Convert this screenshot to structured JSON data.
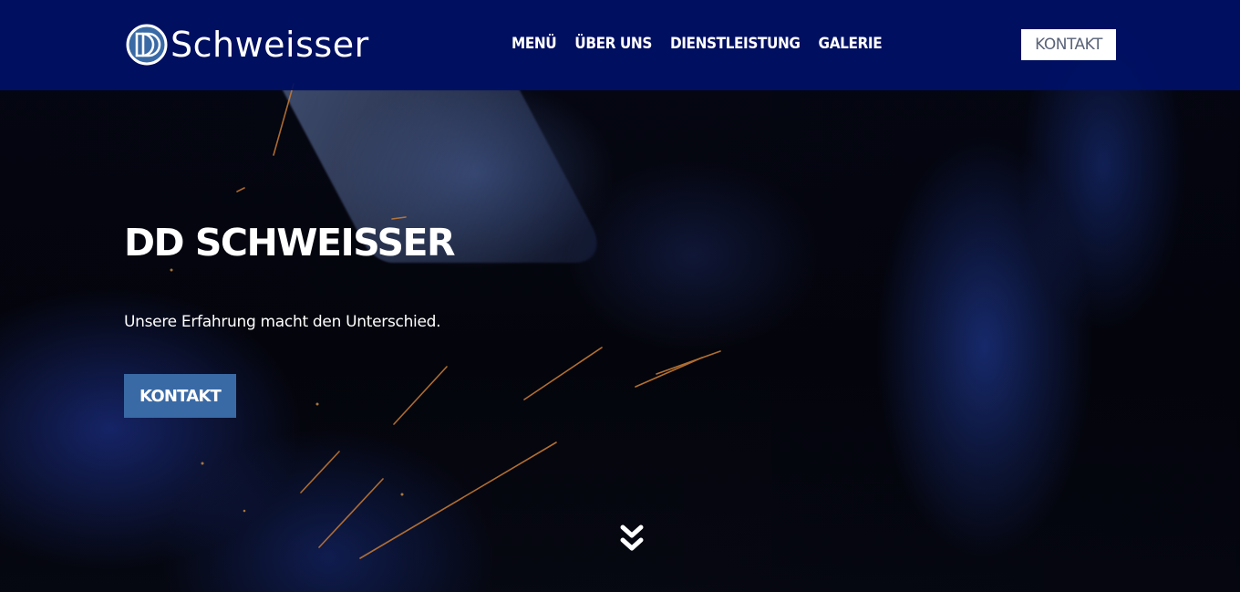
{
  "header": {
    "logo": {
      "mark_text": "DD",
      "brand_text": "Schweisser"
    },
    "nav": {
      "items": [
        {
          "label": "MENÜ"
        },
        {
          "label": "ÜBER UNS"
        },
        {
          "label": "DIENSTLEISTUNG"
        },
        {
          "label": "GALERIE"
        }
      ]
    },
    "contact_button": "KONTAKT"
  },
  "hero": {
    "title": "DD SCHWEISSER",
    "subtitle": "Unsere Erfahrung macht den Unterschied.",
    "cta_label": "KONTAKT",
    "scroll_icon": "double-chevron-down-icon"
  },
  "colors": {
    "header_bg": "#001066",
    "cta_bg": "#3a6aa5",
    "text": "#ffffff",
    "contact_text": "#5a6378"
  }
}
